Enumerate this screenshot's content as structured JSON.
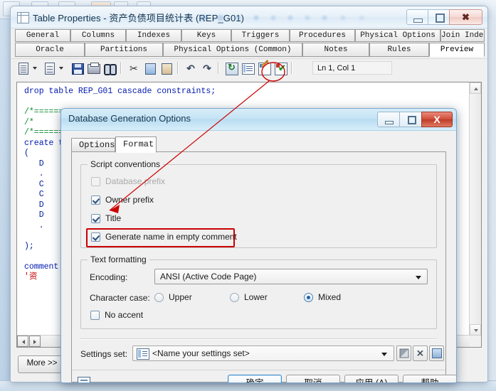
{
  "window": {
    "title": "Table Properties - 资产负债项目统计表 (REP_G01)",
    "icon": "table-icon",
    "controls": {
      "minimize": "–",
      "maximize": "□",
      "close": "✕"
    }
  },
  "tabs_row1": [
    "General",
    "Columns",
    "Indexes",
    "Keys",
    "Triggers",
    "Procedures",
    "Physical Options",
    "Join Index"
  ],
  "tabs_row2": [
    "Oracle",
    "Partitions",
    "Physical Options (Common)",
    "Notes",
    "Rules",
    "Preview"
  ],
  "active_tab": "Preview",
  "toolbar": {
    "icons": [
      "new-document-icon",
      "dropdown-caret-icon",
      "edit-document-icon",
      "dropdown-caret-icon",
      "save-icon",
      "print-icon",
      "find-icon",
      "cut-icon",
      "copy-icon",
      "paste-icon",
      "undo-icon",
      "redo-icon",
      "refresh-icon",
      "list-icon",
      "edit-script-icon",
      "check-script-icon"
    ],
    "position_label": "Ln 1, Col 1"
  },
  "editor": {
    "lines": [
      "drop table REP_G01 cascade constraints;",
      "",
      "/*==========",
      "/*  ",
      "/*==========",
      "create table",
      "(",
      "   D",
      "   .",
      "   C",
      "   C",
      "   D",
      "   D",
      "   .",
      "",
      ");",
      "",
      "comment",
      "'资"
    ]
  },
  "more_button": "More >>",
  "dialog": {
    "title": "Database Generation Options",
    "controls": {
      "minimize": "–",
      "maximize": "□",
      "close": "X"
    },
    "tabs": [
      "Options",
      "Format"
    ],
    "active_tab": "Format",
    "script_conventions": {
      "legend": "Script conventions",
      "items": [
        {
          "label": "Database prefix",
          "checked": false,
          "disabled": true,
          "highlighted": false
        },
        {
          "label": "Owner prefix",
          "checked": true,
          "disabled": false,
          "highlighted": false
        },
        {
          "label": "Title",
          "checked": true,
          "disabled": false,
          "highlighted": false
        },
        {
          "label": "Generate name in empty comment",
          "checked": true,
          "disabled": false,
          "highlighted": true
        }
      ]
    },
    "text_formatting": {
      "legend": "Text formatting",
      "encoding_label": "Encoding:",
      "encoding_value": "ANSI (Active Code Page)",
      "character_case_label": "Character case:",
      "character_case_options": [
        {
          "label": "Upper",
          "selected": false
        },
        {
          "label": "Lower",
          "selected": false
        },
        {
          "label": "Mixed",
          "selected": true
        }
      ],
      "no_accent": {
        "label": "No accent",
        "checked": false
      }
    },
    "settings_set": {
      "label": "Settings set:",
      "value": "<Name your settings set>",
      "buttons": [
        "save-settings-icon",
        "delete-settings-icon",
        "settings-properties-icon"
      ]
    },
    "footer": {
      "report_icon": "report-icon",
      "report_caret": "dropdown-caret-icon",
      "buttons": [
        {
          "label": "确定",
          "default": true
        },
        {
          "label": "取消",
          "default": false
        },
        {
          "label": "应用 (A)",
          "default": false
        },
        {
          "label": "帮助",
          "default": false
        }
      ]
    }
  },
  "annotations": {
    "circle_target": "edit-script-icon",
    "arrow_target": "title-checkbox",
    "color": "#cc0000"
  }
}
